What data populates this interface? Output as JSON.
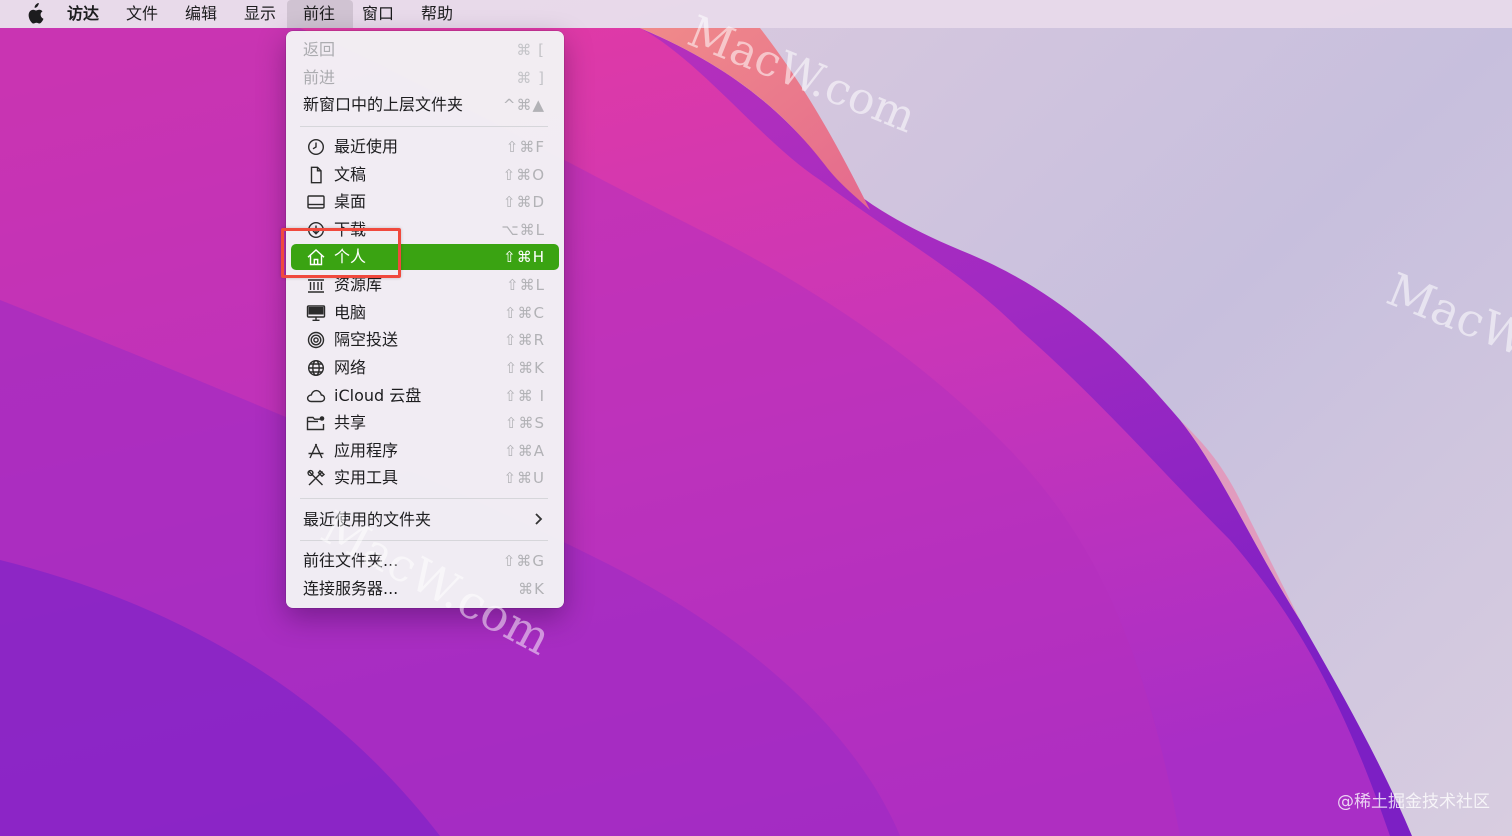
{
  "menubar": {
    "items": [
      {
        "label": "访达"
      },
      {
        "label": "文件"
      },
      {
        "label": "编辑"
      },
      {
        "label": "显示"
      },
      {
        "label": "前往"
      },
      {
        "label": "窗口"
      },
      {
        "label": "帮助"
      }
    ],
    "active_item": "前往"
  },
  "go_menu": {
    "items": [
      {
        "label": "返回",
        "shortcut": "⌘ [",
        "enabled": false
      },
      {
        "label": "前进",
        "shortcut": "⌘ ]",
        "enabled": false
      },
      {
        "label": "新窗口中的上层文件夹",
        "shortcut": "^⌘▲",
        "enabled": true
      },
      {
        "label": "最近使用",
        "shortcut": "⇧⌘F",
        "icon": "clock-icon"
      },
      {
        "label": "文稿",
        "shortcut": "⇧⌘O",
        "icon": "document-icon"
      },
      {
        "label": "桌面",
        "shortcut": "⇧⌘D",
        "icon": "desktop-icon"
      },
      {
        "label": "下载",
        "shortcut": "⌥⌘L",
        "icon": "download-icon"
      },
      {
        "label": "个人",
        "shortcut": "⇧⌘H",
        "icon": "home-icon",
        "highlighted": true
      },
      {
        "label": "资源库",
        "shortcut": "⇧⌘L",
        "icon": "library-icon"
      },
      {
        "label": "电脑",
        "shortcut": "⇧⌘C",
        "icon": "computer-icon"
      },
      {
        "label": "隔空投送",
        "shortcut": "⇧⌘R",
        "icon": "airdrop-icon"
      },
      {
        "label": "网络",
        "shortcut": "⇧⌘K",
        "icon": "network-icon"
      },
      {
        "label": "iCloud 云盘",
        "shortcut": "⇧⌘ I",
        "icon": "cloud-icon"
      },
      {
        "label": "共享",
        "shortcut": "⇧⌘S",
        "icon": "shared-folder-icon"
      },
      {
        "label": "应用程序",
        "shortcut": "⇧⌘A",
        "icon": "applications-icon"
      },
      {
        "label": "实用工具",
        "shortcut": "⇧⌘U",
        "icon": "utilities-icon"
      },
      {
        "label": "最近使用的文件夹",
        "submenu": true
      },
      {
        "label": "前往文件夹...",
        "shortcut": "⇧⌘G"
      },
      {
        "label": "连接服务器...",
        "shortcut": "⌘K"
      }
    ]
  },
  "colors": {
    "highlight": "#3aa312",
    "annotation_box": "#f0493d"
  },
  "watermarks": [
    "MacW.com",
    "MacW",
    "MacW.com"
  ],
  "credit": "@稀土掘金技术社区"
}
